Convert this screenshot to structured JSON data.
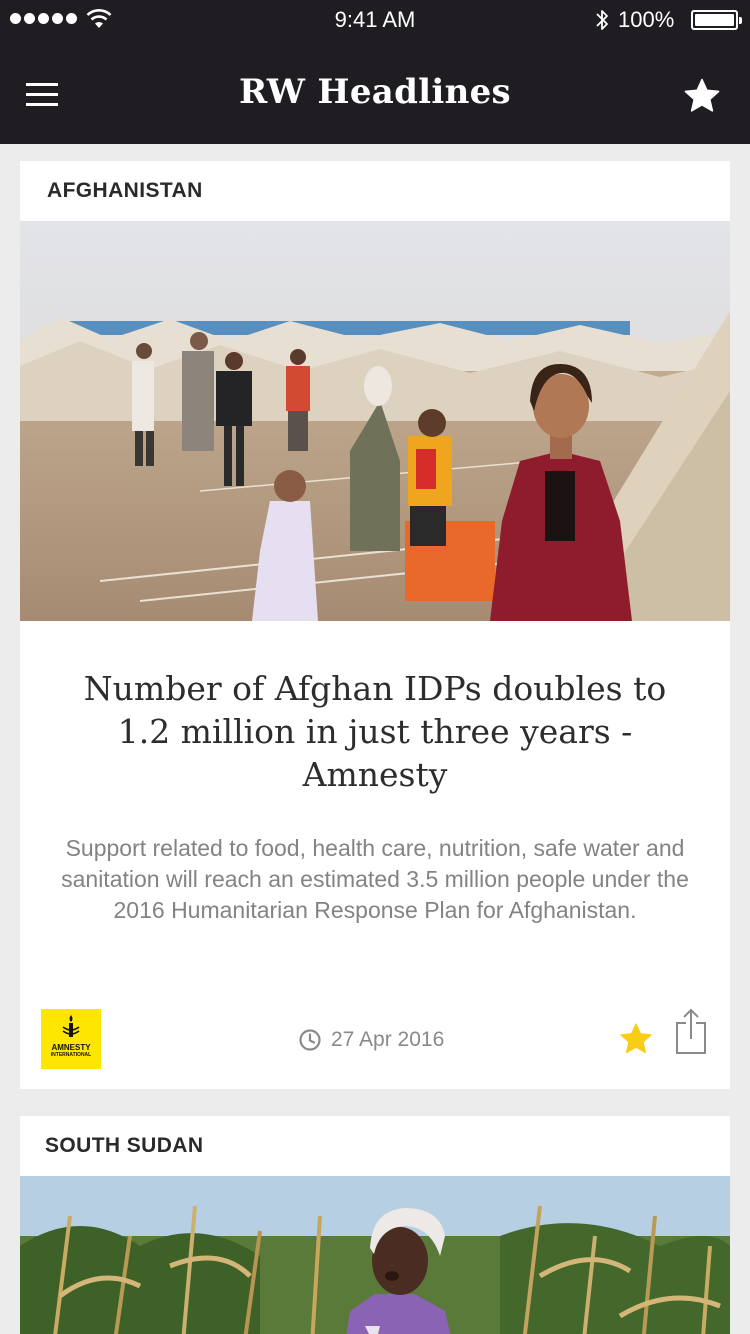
{
  "status_bar": {
    "time": "9:41 AM",
    "battery": "100%"
  },
  "nav": {
    "title": "RW Headlines",
    "menu_icon": "hamburger-icon",
    "favorites_icon": "star-icon"
  },
  "articles": [
    {
      "region": "AFGHANISTAN",
      "image": "refugee-camp-photo",
      "headline": "Number of Afghan IDPs doubles to 1.2 million in just three years - Amnesty",
      "summary": "Support related to food, health care, nutrition, safe water and sanitation will reach an estimated 3.5 million people under the 2016 Humanitarian Response Plan for Afghanistan.",
      "source_logo": {
        "line1": "AMNESTY",
        "line2": "INTERNATIONAL",
        "color": "#ffe600"
      },
      "date": "27 Apr 2016",
      "bookmarked": true
    },
    {
      "region": "SOUTH SUDAN",
      "image": "cornfield-woman-photo"
    }
  ],
  "colors": {
    "bar": "#1f1d22",
    "background": "#ececec",
    "star_active": "#f7cd17"
  }
}
